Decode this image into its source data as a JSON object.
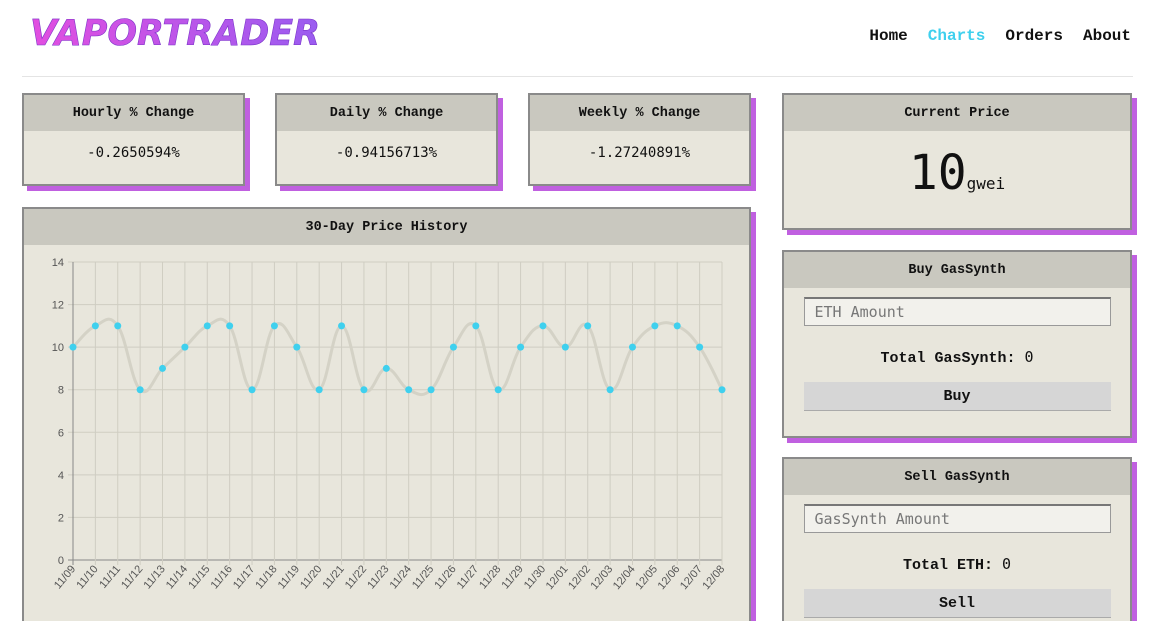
{
  "brand": {
    "name": "VAPORTRADER"
  },
  "nav": [
    {
      "label": "Home",
      "active": false
    },
    {
      "label": "Charts",
      "active": true
    },
    {
      "label": "Orders",
      "active": false
    },
    {
      "label": "About",
      "active": false
    }
  ],
  "stats": {
    "hourly": {
      "title": "Hourly % Change",
      "value": "-0.2650594%"
    },
    "daily": {
      "title": "Daily % Change",
      "value": "-0.94156713%"
    },
    "weekly": {
      "title": "Weekly % Change",
      "value": "-1.27240891%"
    }
  },
  "current_price": {
    "title": "Current Price",
    "value": "10",
    "unit": "gwei"
  },
  "buy": {
    "title": "Buy GasSynth",
    "placeholder": "ETH Amount",
    "total_label": "Total GasSynth:",
    "total_value": "0",
    "button": "Buy"
  },
  "sell": {
    "title": "Sell GasSynth",
    "placeholder": "GasSynth Amount",
    "total_label": "Total ETH:",
    "total_value": "0",
    "button": "Sell"
  },
  "colors": {
    "accent": "#3fd0ee",
    "shadow": "#c060e0",
    "panel": "#e8e6dc",
    "header": "#c9c8bf",
    "line": "#d4d2c6"
  },
  "chart_data": {
    "type": "line",
    "title": "30-Day Price History",
    "x": [
      "11/09",
      "11/10",
      "11/11",
      "11/12",
      "11/13",
      "11/14",
      "11/15",
      "11/16",
      "11/17",
      "11/18",
      "11/19",
      "11/20",
      "11/21",
      "11/22",
      "11/23",
      "11/24",
      "11/25",
      "11/26",
      "11/27",
      "11/28",
      "11/29",
      "11/30",
      "12/01",
      "12/02",
      "12/03",
      "12/04",
      "12/05",
      "12/06",
      "12/07",
      "12/08"
    ],
    "values": [
      10,
      11,
      11,
      8,
      9,
      10,
      11,
      11,
      8,
      11,
      10,
      8,
      11,
      8,
      9,
      8,
      8,
      10,
      11,
      8,
      10,
      11,
      10,
      11,
      8,
      10,
      11,
      11,
      10,
      8
    ],
    "ylim": [
      0,
      14
    ],
    "yticks": [
      0,
      2,
      4,
      6,
      8,
      10,
      12,
      14
    ],
    "grid": true,
    "xlabel": "",
    "ylabel": ""
  }
}
